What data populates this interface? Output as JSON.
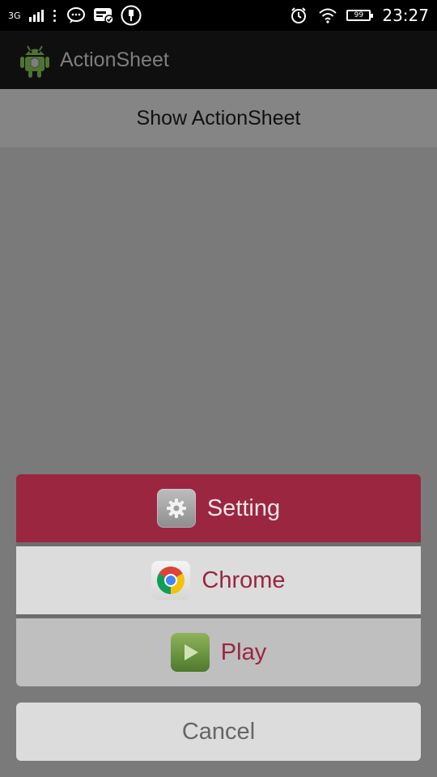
{
  "status_bar": {
    "network": "3G",
    "battery": "99",
    "time": "23:27",
    "icons": [
      "signal-icon",
      "more-dots-icon",
      "chat-bubble-icon",
      "notification-card-icon",
      "usb-icon",
      "alarm-icon",
      "wifi-icon",
      "battery-icon"
    ]
  },
  "action_bar": {
    "title": "ActionSheet",
    "icon": "android-robot-icon"
  },
  "content": {
    "show_button": "Show ActionSheet"
  },
  "action_sheet": {
    "items": [
      {
        "label": "Setting",
        "icon": "gear-icon",
        "selected": true
      },
      {
        "label": "Chrome",
        "icon": "chrome-icon"
      },
      {
        "label": "Play",
        "icon": "play-icon"
      }
    ],
    "cancel": "Cancel"
  },
  "colors": {
    "accent": "#9b2640",
    "label_text": "#962741",
    "overlay": "#7a7a7a"
  }
}
